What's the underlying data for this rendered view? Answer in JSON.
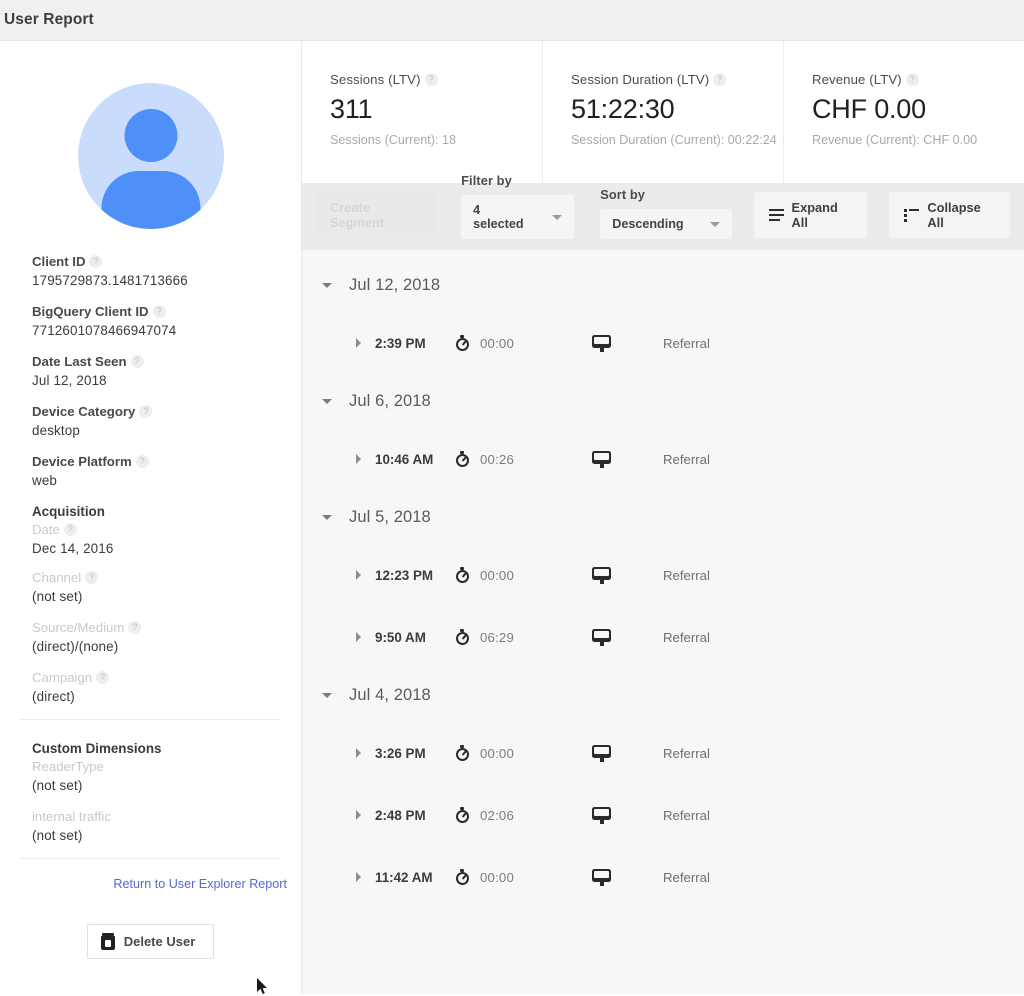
{
  "window": {
    "title": "User Report"
  },
  "colors": {
    "accent": "#4e90f7",
    "avatar_bg": "#c9dcfc",
    "link": "#5368d4",
    "toolbar_bg": "#ebebeb",
    "list_bg": "#f7f7f7"
  },
  "sidebar": {
    "avatar_icon": "user-avatar-icon",
    "fields": [
      {
        "label": "Client ID",
        "help": "?",
        "value": "1795729873.1481713666",
        "muted_label": false
      },
      {
        "label": "BigQuery Client ID",
        "help": "?",
        "value": "7712601078466947074",
        "muted_label": false
      },
      {
        "label": "Date Last Seen",
        "help": "?",
        "value": "Jul 12, 2018",
        "muted_label": false
      },
      {
        "label": "Device Category",
        "help": "?",
        "value": "desktop",
        "muted_label": false
      },
      {
        "label": "Device Platform",
        "help": "?",
        "value": "web",
        "muted_label": false
      }
    ],
    "acquisition": {
      "heading": "Acquisition",
      "rows": [
        {
          "label": "Date",
          "help": "?",
          "value": "Dec 14, 2016"
        },
        {
          "label": "Channel",
          "help": "?",
          "value": "(not set)"
        },
        {
          "label": "Source/Medium",
          "help": "?",
          "value": "(direct)/(none)"
        },
        {
          "label": "Campaign",
          "help": "?",
          "value": "(direct)"
        }
      ]
    },
    "custom_dimensions": {
      "heading": "Custom Dimensions",
      "rows": [
        {
          "label": "ReaderType",
          "value": "(not set)"
        },
        {
          "label": "internal traffic",
          "value": "(not set)"
        }
      ]
    },
    "return_link": "Return to User Explorer Report",
    "delete_button": {
      "label": "Delete User",
      "icon": "trash-icon"
    }
  },
  "cards": [
    {
      "title": "Sessions (LTV)",
      "help": "?",
      "value": "311",
      "subtitle": "Sessions (Current): 18"
    },
    {
      "title": "Session Duration (LTV)",
      "help": "?",
      "value": "51:22:30",
      "subtitle": "Session Duration (Current): 00:22:24"
    },
    {
      "title": "Revenue (LTV)",
      "help": "?",
      "value": "CHF 0.00",
      "subtitle": "Revenue (Current): CHF 0.00"
    }
  ],
  "toolbar": {
    "create_segment_label": "Create Segment",
    "filter_by_caption": "Filter by",
    "filter_by_value": "4 selected",
    "sort_by_caption": "Sort by",
    "sort_by_value": "Descending",
    "expand_all_label": "Expand All",
    "expand_all_icon": "expand-list-icon",
    "collapse_all_label": "Collapse All",
    "collapse_all_icon": "collapse-list-icon"
  },
  "sessions": [
    {
      "date": "Jul 12, 2018",
      "rows": [
        {
          "time": "2:39 PM",
          "duration": "00:00",
          "device_icon": "desktop-monitor-icon",
          "channel": "Referral"
        }
      ]
    },
    {
      "date": "Jul 6, 2018",
      "rows": [
        {
          "time": "10:46 AM",
          "duration": "00:26",
          "device_icon": "desktop-monitor-icon",
          "channel": "Referral"
        }
      ]
    },
    {
      "date": "Jul 5, 2018",
      "rows": [
        {
          "time": "12:23 PM",
          "duration": "00:00",
          "device_icon": "desktop-monitor-icon",
          "channel": "Referral"
        },
        {
          "time": "9:50 AM",
          "duration": "06:29",
          "device_icon": "desktop-monitor-icon",
          "channel": "Referral"
        }
      ]
    },
    {
      "date": "Jul 4, 2018",
      "rows": [
        {
          "time": "3:26 PM",
          "duration": "00:00",
          "device_icon": "desktop-monitor-icon",
          "channel": "Referral"
        },
        {
          "time": "2:48 PM",
          "duration": "02:06",
          "device_icon": "desktop-monitor-icon",
          "channel": "Referral"
        },
        {
          "time": "11:42 AM",
          "duration": "00:00",
          "device_icon": "desktop-monitor-icon",
          "channel": "Referral"
        }
      ]
    }
  ]
}
